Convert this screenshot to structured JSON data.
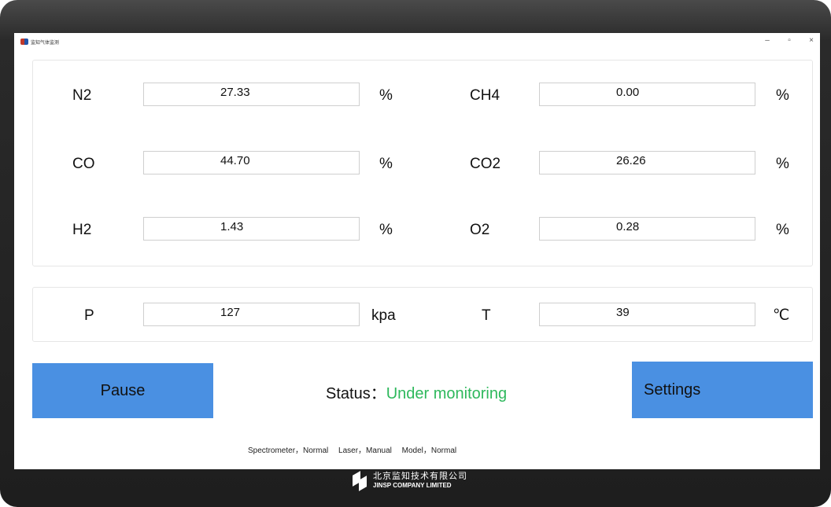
{
  "window": {
    "title": "监知气体监测",
    "controls": {
      "minimize": "–",
      "maximize": "▫",
      "close": "×"
    }
  },
  "gases": [
    {
      "name": "N2",
      "value": "27.33",
      "unit": "%"
    },
    {
      "name": "CH4",
      "value": "0.00",
      "unit": "%"
    },
    {
      "name": "CO",
      "value": "44.70",
      "unit": "%"
    },
    {
      "name": "CO2",
      "value": "26.26",
      "unit": "%"
    },
    {
      "name": "H2",
      "value": "1.43",
      "unit": "%"
    },
    {
      "name": "O2",
      "value": "0.28",
      "unit": "%"
    }
  ],
  "environment": [
    {
      "name": "P",
      "value": "127",
      "unit": "kpa"
    },
    {
      "name": "T",
      "value": "39",
      "unit": "℃"
    }
  ],
  "buttons": {
    "pause": "Pause",
    "settings": "Settings"
  },
  "status": {
    "label": "Status：",
    "value": "Under monitoring",
    "value_color": "#2eb85c"
  },
  "subsystems": {
    "spectrometer": "Spectrometer，Normal",
    "laser": "Laser，Manual",
    "model": "Model，Normal"
  },
  "footer": {
    "company_cn": "北京监知技术有限公司",
    "company_en": "JINSP COMPANY LIMITED"
  },
  "colors": {
    "button": "#4a90e2",
    "frame": "#1e1e1e"
  }
}
